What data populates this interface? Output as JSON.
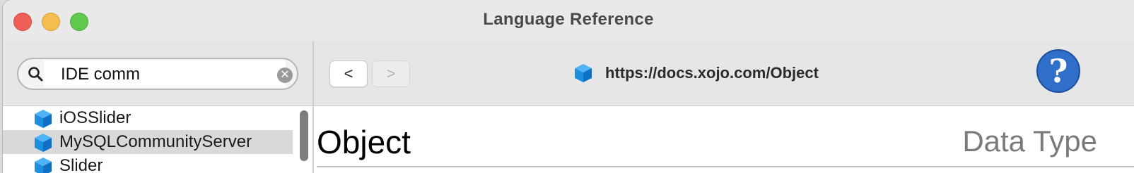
{
  "window": {
    "title": "Language Reference"
  },
  "search": {
    "value": "IDE comm"
  },
  "sidebar": {
    "items": [
      {
        "label": "iOSSlider",
        "selected": false
      },
      {
        "label": "MySQLCommunityServer",
        "selected": true
      },
      {
        "label": "Slider",
        "selected": false
      }
    ]
  },
  "toolbar": {
    "back_label": "<",
    "forward_label": ">",
    "url": "https://docs.xojo.com/Object",
    "help_label": "?"
  },
  "content": {
    "title": "Object",
    "kind": "Data Type"
  },
  "colors": {
    "close": "#ee5f57",
    "minimize": "#f5bd4f",
    "maximize": "#5fc94e",
    "help": "#2f6fca",
    "cube": "#1e8fe0",
    "selection": "#d9d9d9"
  }
}
